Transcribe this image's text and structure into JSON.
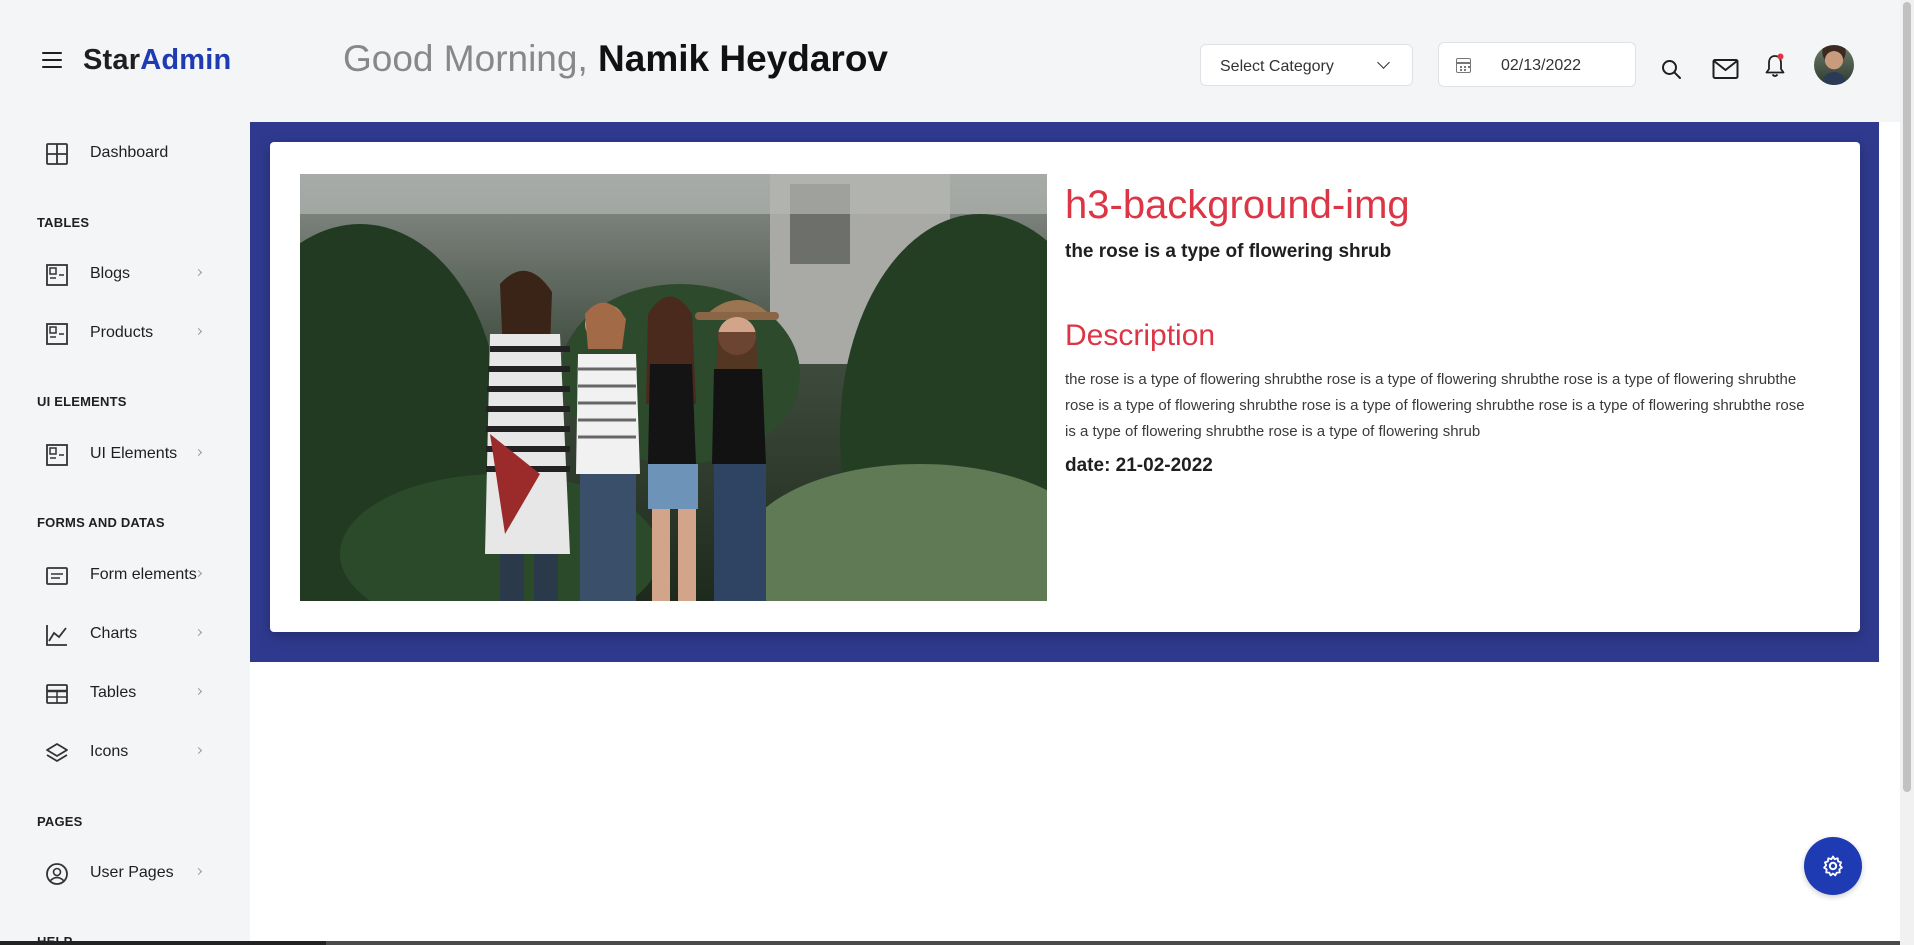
{
  "brand": {
    "part1": "Star",
    "part2": "Admin"
  },
  "greeting": {
    "prefix": "Good Morning, ",
    "name": "Namik Heydarov"
  },
  "header": {
    "category_select": "Select Category",
    "date_value": "02/13/2022"
  },
  "sidebar": {
    "dashboard": "Dashboard",
    "sections": {
      "tables": "TABLES",
      "ui_elements": "UI ELEMENTS",
      "forms_and_datas": "FORMS AND DATAS",
      "pages": "PAGES",
      "help": "HELP"
    },
    "items": {
      "blogs": "Blogs",
      "products": "Products",
      "ui_elements": "UI Elements",
      "form_elements": "Form elements",
      "charts": "Charts",
      "tables": "Tables",
      "icons": "Icons",
      "user_pages": "User Pages"
    }
  },
  "card": {
    "title": "h3-background-img",
    "subtitle": "the rose is a type of flowering shrub",
    "description_heading": "Description",
    "description": "the rose is a type of flowering shrubthe rose is a type of flowering shrubthe rose is a type of flowering shrubthe rose is a type of flowering shrubthe rose is a type of flowering shrubthe rose is a type of flowering shrubthe rose is a type of flowering shrubthe rose is a type of flowering shrub",
    "date": "date: 21-02-2022"
  },
  "colors": {
    "brand_blue": "#1f3bb3",
    "banner": "#2f3a8f",
    "accent_red": "#dc3545"
  },
  "icons": [
    "menu-icon",
    "chevron-down-icon",
    "calendar-icon",
    "search-icon",
    "mail-icon",
    "bell-icon",
    "grid-icon",
    "layout-icon",
    "form-icon",
    "chart-icon",
    "table-icon",
    "layers-icon",
    "user-circle-icon",
    "gear-icon"
  ]
}
